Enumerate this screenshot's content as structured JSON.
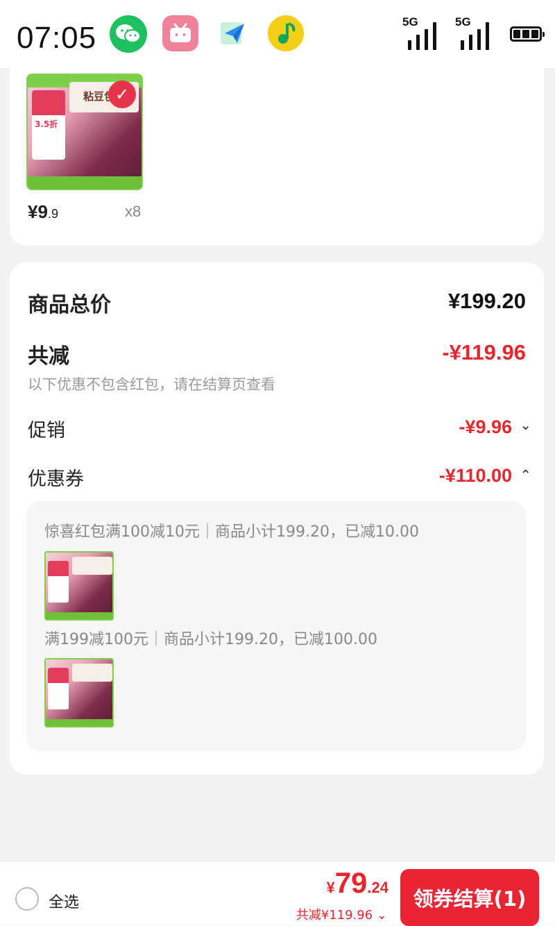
{
  "status_bar": {
    "time": "07:05",
    "signal_1": "5G",
    "signal_2": "5G",
    "apps": [
      "wechat-icon",
      "bilibili-icon",
      "paper-plane-icon",
      "music-icon"
    ]
  },
  "product": {
    "price_symbol": "¥",
    "price_int": "9",
    "price_dec": ".9",
    "quantity": "x8",
    "thumb_text": "粘豆包",
    "thumb_tag": "3.5折"
  },
  "summary": {
    "total_label": "商品总价",
    "total_value": "¥199.20",
    "reduce_label": "共减",
    "reduce_value": "-¥119.96",
    "reduce_note": "以下优惠不包含红包，请在结算页查看",
    "promo_label": "促销",
    "promo_value": "-¥9.96",
    "coupon_label": "优惠券",
    "coupon_value": "-¥110.00"
  },
  "coupons": [
    {
      "text": "惊喜红包满100减10元｜商品小计199.20，已减10.00"
    },
    {
      "text": "满199减100元｜商品小计199.20，已减100.00"
    }
  ],
  "bottom": {
    "select_all": "全选",
    "total_symbol": "¥",
    "total_int": "79",
    "total_dec": ".24",
    "saved": "共减¥119.96 ⌄",
    "checkout_label": "领券结算(1)"
  },
  "colors": {
    "accent_red": "#ea2533",
    "discount_red": "#e8262e"
  }
}
